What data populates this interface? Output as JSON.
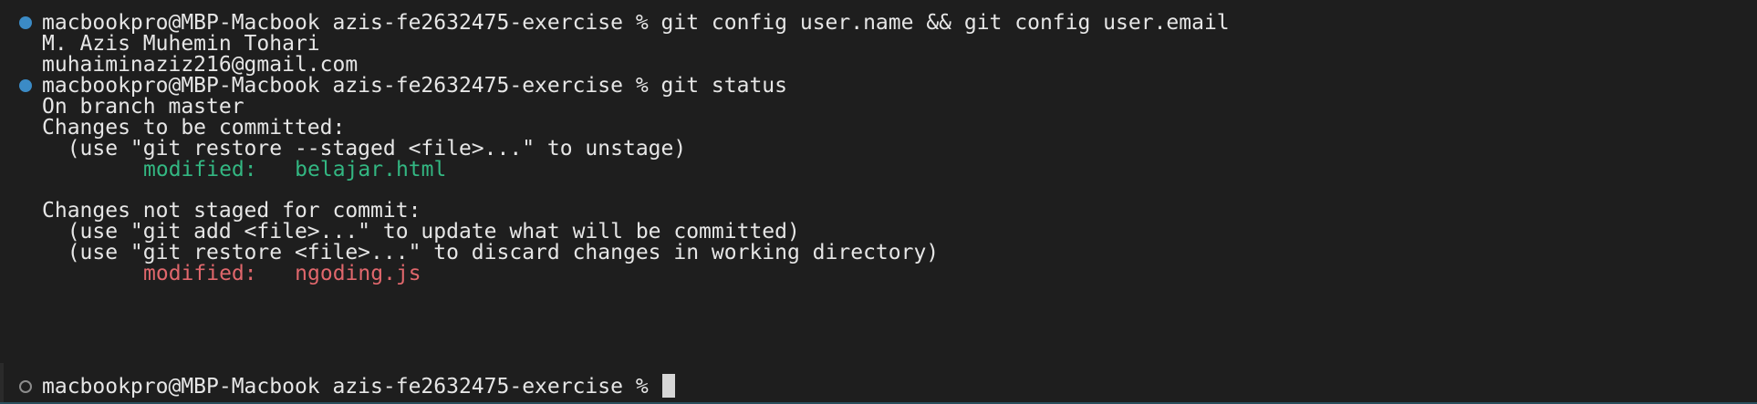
{
  "terminal": {
    "blocks": [
      {
        "status": "done",
        "prompt": "macbookpro@MBP-Macbook azis-fe2632475-exercise %",
        "command": "git config user.name && git config user.email",
        "output": [
          "M. Azis Muhemin Tohari",
          "muhaiminaziz216@gmail.com"
        ]
      },
      {
        "status": "done",
        "prompt": "macbookpro@MBP-Macbook azis-fe2632475-exercise %",
        "command": "git status",
        "output": {
          "branch": "On branch master",
          "staged_header": "Changes to be committed:",
          "staged_hint": "  (use \"git restore --staged <file>...\" to unstage)",
          "staged_label": "modified:",
          "staged_file": "belajar.html",
          "unstaged_header": "Changes not staged for commit:",
          "unstaged_hint_1": "  (use \"git add <file>...\" to update what will be committed)",
          "unstaged_hint_2": "  (use \"git restore <file>...\" to discard changes in working directory)",
          "unstaged_label": "modified:",
          "unstaged_file": "ngoding.js"
        }
      },
      {
        "status": "pending",
        "prompt": "macbookpro@MBP-Macbook azis-fe2632475-exercise %",
        "command": ""
      }
    ],
    "colors": {
      "background": "#1e1e1e",
      "text": "#e6e6e6",
      "success_mark": "#3b8bc6",
      "staged": "#33b782",
      "unstaged": "#e0676c"
    }
  }
}
